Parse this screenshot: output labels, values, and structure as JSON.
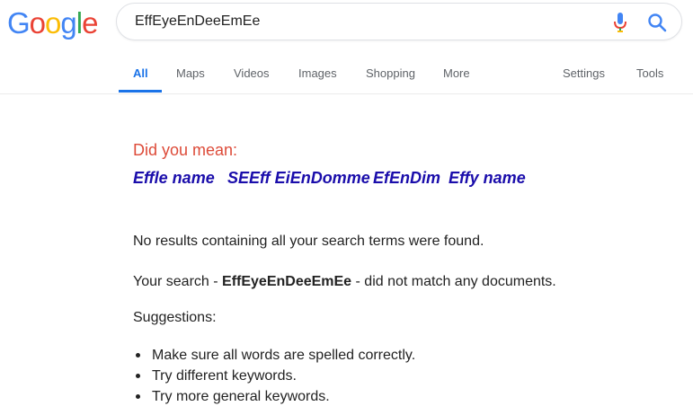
{
  "logo": {
    "letters": [
      "G",
      "o",
      "o",
      "g",
      "l",
      "e"
    ],
    "colors": [
      "#4285f4",
      "#ea4335",
      "#fbbc05",
      "#4285f4",
      "#34a853",
      "#ea4335"
    ]
  },
  "search": {
    "query": "EffEyeEnDeeEmEe",
    "icons": [
      "microphone-icon",
      "search-icon"
    ]
  },
  "tabs": {
    "all": "All",
    "maps": "Maps",
    "videos": "Videos",
    "images": "Images",
    "shopping": "Shopping",
    "more": "More",
    "settings": "Settings",
    "tools": "Tools"
  },
  "did_you_mean": {
    "label": "Did you mean:",
    "suggestions": [
      "Effle name",
      "SEEff EiEnDomme",
      "EfEnDim",
      "Effy name"
    ]
  },
  "results": {
    "no_results": "No results containing all your search terms were found.",
    "your_search_prefix": "Your search - ",
    "your_search_query": "EffEyeEnDeeEmEe",
    "your_search_suffix": " - did not match any documents.",
    "suggestions_heading": "Suggestions:",
    "tips": [
      "Make sure all words are spelled correctly.",
      "Try different keywords.",
      "Try more general keywords."
    ]
  },
  "colors": {
    "accent": "#1a73e8",
    "link": "#1a0dab",
    "did_you_mean": "#dd4b39"
  }
}
